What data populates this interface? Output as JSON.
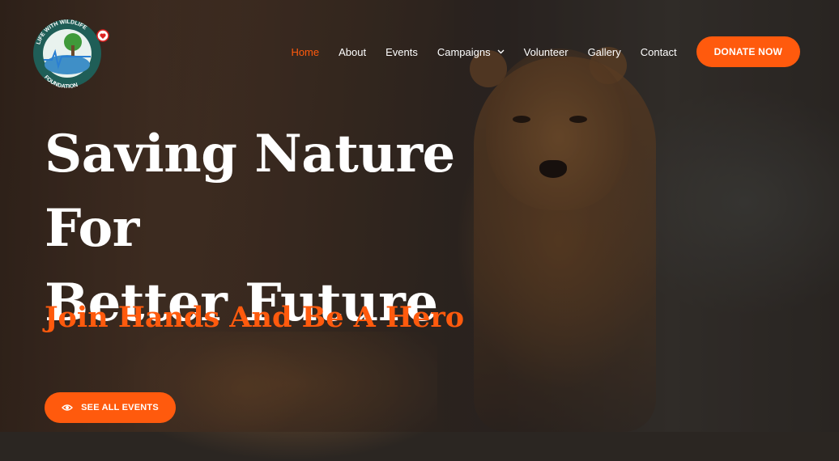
{
  "logo": {
    "ring_text_top": "LIFE WITH WILDLIFE",
    "ring_text_bottom": "FOUNDATION"
  },
  "nav": {
    "items": [
      {
        "label": "Home",
        "active": true
      },
      {
        "label": "About"
      },
      {
        "label": "Events"
      },
      {
        "label": "Campaigns",
        "has_dropdown": true
      },
      {
        "label": "Volunteer"
      },
      {
        "label": "Gallery"
      },
      {
        "label": "Contact"
      }
    ],
    "donate_label": "DONATE NOW"
  },
  "hero": {
    "headline_line1": "Saving Nature For",
    "headline_line2": "Better Future",
    "tagline": "Join Hands And Be A Hero",
    "cta_label": "SEE ALL EVENTS",
    "cta_icon": "eye-icon"
  },
  "colors": {
    "accent": "#ff5a0d",
    "text": "#ffffff"
  }
}
